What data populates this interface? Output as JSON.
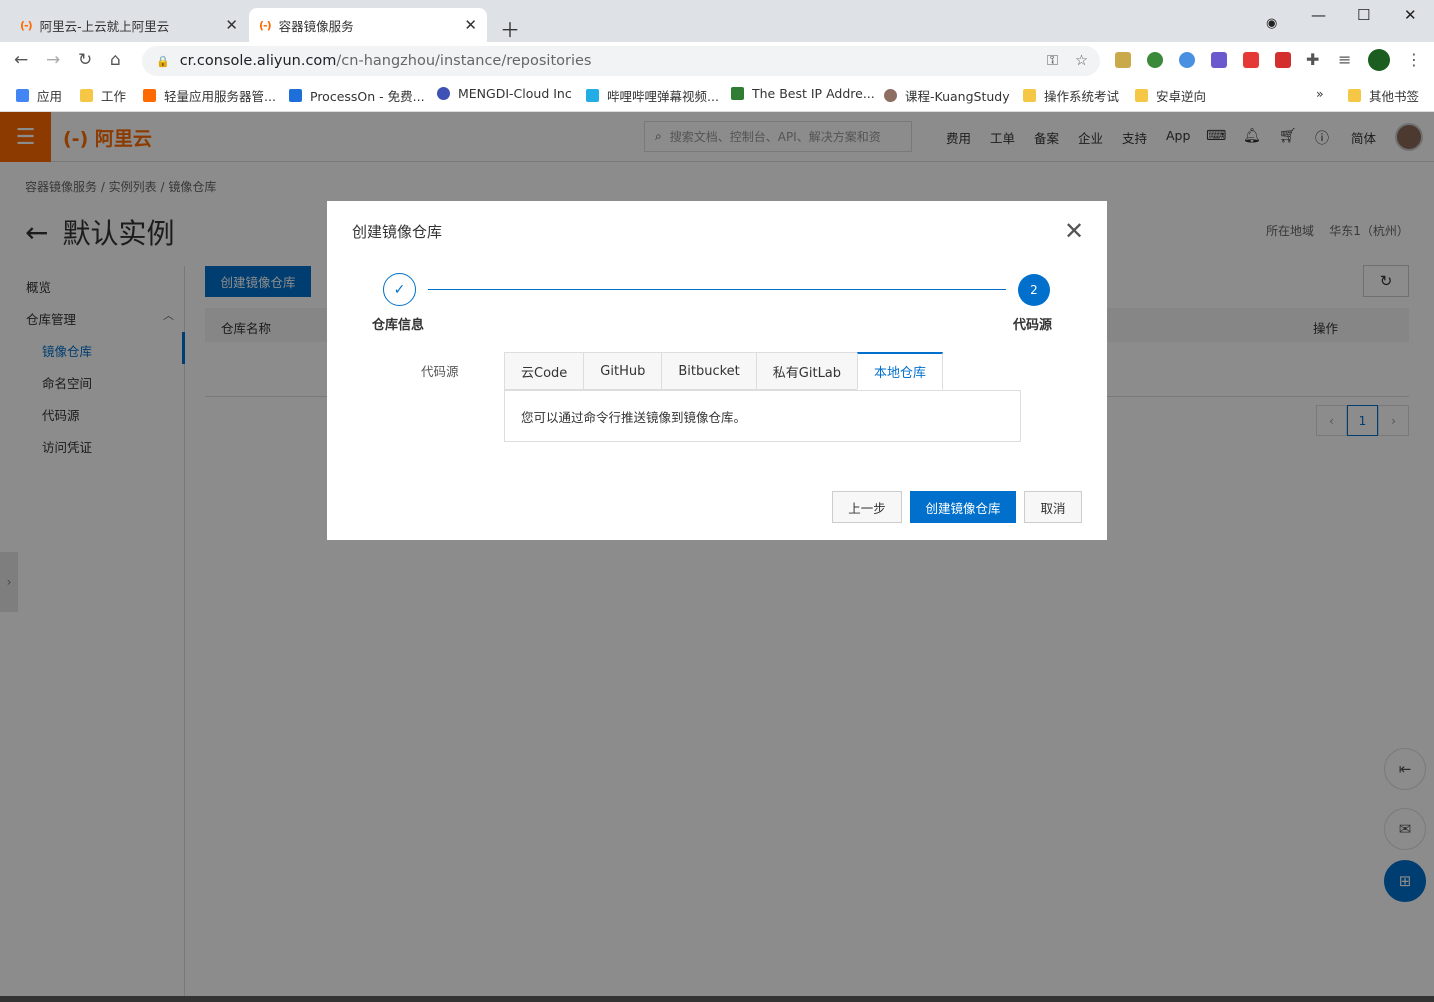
{
  "browser": {
    "tabs": [
      {
        "title": "阿里云-上云就上阿里云",
        "favicon": "(-)"
      },
      {
        "title": "容器镜像服务",
        "favicon": "(-)"
      }
    ],
    "url_host": "cr.console.aliyun.com",
    "url_path": "/cn-hangzhou/instance/repositories",
    "bookmarks": [
      "应用",
      "工作",
      "轻量应用服务器管...",
      "ProcessOn - 免费...",
      "MENGDI-Cloud Inc",
      "哔哩哔哩弹幕视频...",
      "The Best IP Addre...",
      "课程-KuangStudy",
      "操作系统考试",
      "安卓逆向"
    ],
    "other_bookmarks": "其他书签",
    "more": "»"
  },
  "console": {
    "logo": "(-) 阿里云",
    "search_placeholder": "搜索文档、控制台、API、解决方案和资",
    "nav": [
      "费用",
      "工单",
      "备案",
      "企业",
      "支持",
      "App"
    ],
    "lang": "简体",
    "breadcrumb": "容器镜像服务 / 实例列表 / 镜像仓库",
    "page_title": "默认实例",
    "region_label": "所在地域",
    "region_value": "华东1（杭州）",
    "sidebar": {
      "overview": "概览",
      "repo_mgmt": "仓库管理",
      "items": [
        "镜像仓库",
        "命名空间",
        "代码源",
        "访问凭证"
      ]
    },
    "create_button": "创建镜像仓库",
    "col_repo_name": "仓库名称",
    "col_ops": "操作",
    "page_current": "1"
  },
  "dialog": {
    "title": "创建镜像仓库",
    "step1_label": "仓库信息",
    "step2_label": "代码源",
    "step2_number": "2",
    "source_label": "代码源",
    "tabs": [
      "云Code",
      "GitHub",
      "Bitbucket",
      "私有GitLab",
      "本地仓库"
    ],
    "active_tab": "本地仓库",
    "tab_content": "您可以通过命令行推送镜像到镜像仓库。",
    "prev_button": "上一步",
    "create_button": "创建镜像仓库",
    "cancel_button": "取消"
  },
  "colors": {
    "accent": "#0070cc",
    "brand": "#ff6a00"
  }
}
